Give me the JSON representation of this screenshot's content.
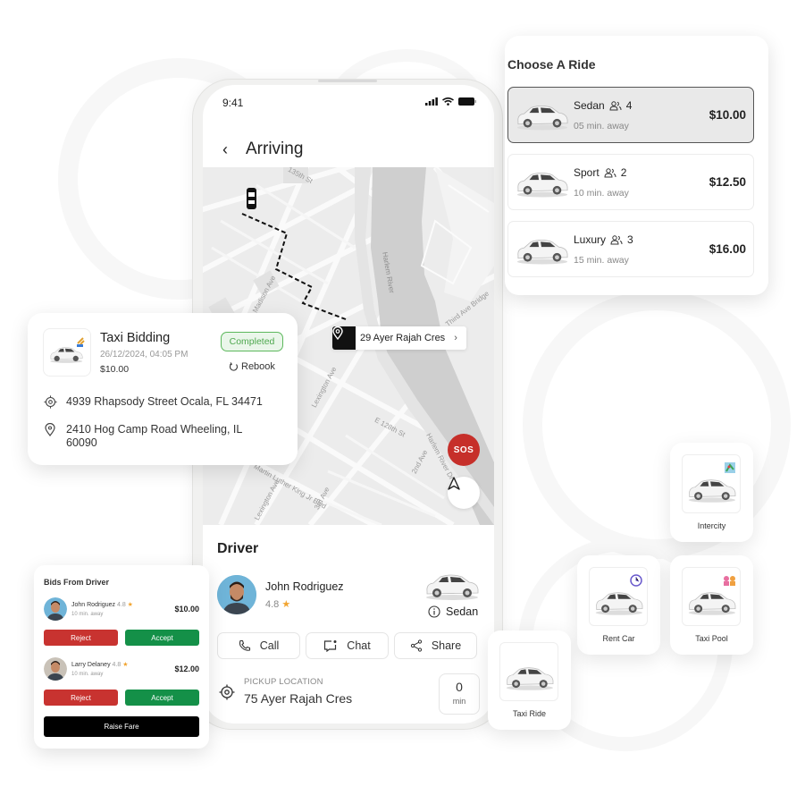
{
  "phone": {
    "status_time": "9:41",
    "header_title": "Arriving",
    "map": {
      "labels": {
        "st_135": "135th St",
        "madison": "Madison Ave",
        "harlem_river": "Harlem River",
        "harlem": "Harlem River Dr",
        "third_ave_bridge": "Third Ave Bridge",
        "third_ave": "Third Ave Br",
        "lexington": "Lexington Ave",
        "e128": "E 128th St",
        "harlem_river_dr": "Harlem River Dr",
        "mlk": "Martin Luther King Jr Blvd",
        "second_ave": "2nd Ave",
        "third_ave_st": "3rd Ave",
        "lexington2": "Lexington Ave"
      },
      "destination": "29 Ayer Rajah Cres",
      "sos_label": "SOS"
    },
    "driver": {
      "heading": "Driver",
      "name": "John Rodriguez",
      "rating": "4.8",
      "vehicle_type": "Sedan",
      "actions": {
        "call": "Call",
        "chat": "Chat",
        "share": "Share"
      },
      "pickup_label": "PICKUP LOCATION",
      "pickup_value": "75 Ayer Rajah Cres",
      "eta_value": "0",
      "eta_unit": "min"
    }
  },
  "choose_ride": {
    "title": "Choose A Ride",
    "options": [
      {
        "name": "Sedan",
        "seats": "4",
        "eta": "05 min. away",
        "price": "$10.00",
        "selected": true
      },
      {
        "name": "Sport",
        "seats": "2",
        "eta": "10 min. away",
        "price": "$12.50",
        "selected": false
      },
      {
        "name": "Luxury",
        "seats": "3",
        "eta": "15 min. away",
        "price": "$16.00",
        "selected": false
      }
    ]
  },
  "taxi_bidding": {
    "title": "Taxi Bidding",
    "datetime": "26/12/2024, 04:05 PM",
    "price": "$10.00",
    "status": "Completed",
    "rebook_label": "Rebook",
    "pickup_address": "4939 Rhapsody Street Ocala, FL 34471",
    "drop_address": "2410 Hog Camp Road Wheeling, IL 60090"
  },
  "bids": {
    "title": "Bids From Driver",
    "items": [
      {
        "name": "John Rodriguez",
        "rating": "4.8",
        "away": "10 min. away",
        "amount": "$10.00",
        "reject": "Reject",
        "accept": "Accept"
      },
      {
        "name": "Larry Delaney",
        "rating": "4.8",
        "away": "10 min. away",
        "amount": "$12.00",
        "reject": "Reject",
        "accept": "Accept"
      }
    ],
    "raise_fare": "Raise Fare"
  },
  "services": {
    "intercity": "Intercity",
    "rent_car": "Rent Car",
    "taxi_pool": "Taxi Pool",
    "taxi_ride": "Taxi Ride"
  },
  "colors": {
    "sos": "#c62f2a",
    "reject": "#c83330",
    "accept": "#149048",
    "completed": "#4fa84f",
    "star": "#f2a531"
  }
}
